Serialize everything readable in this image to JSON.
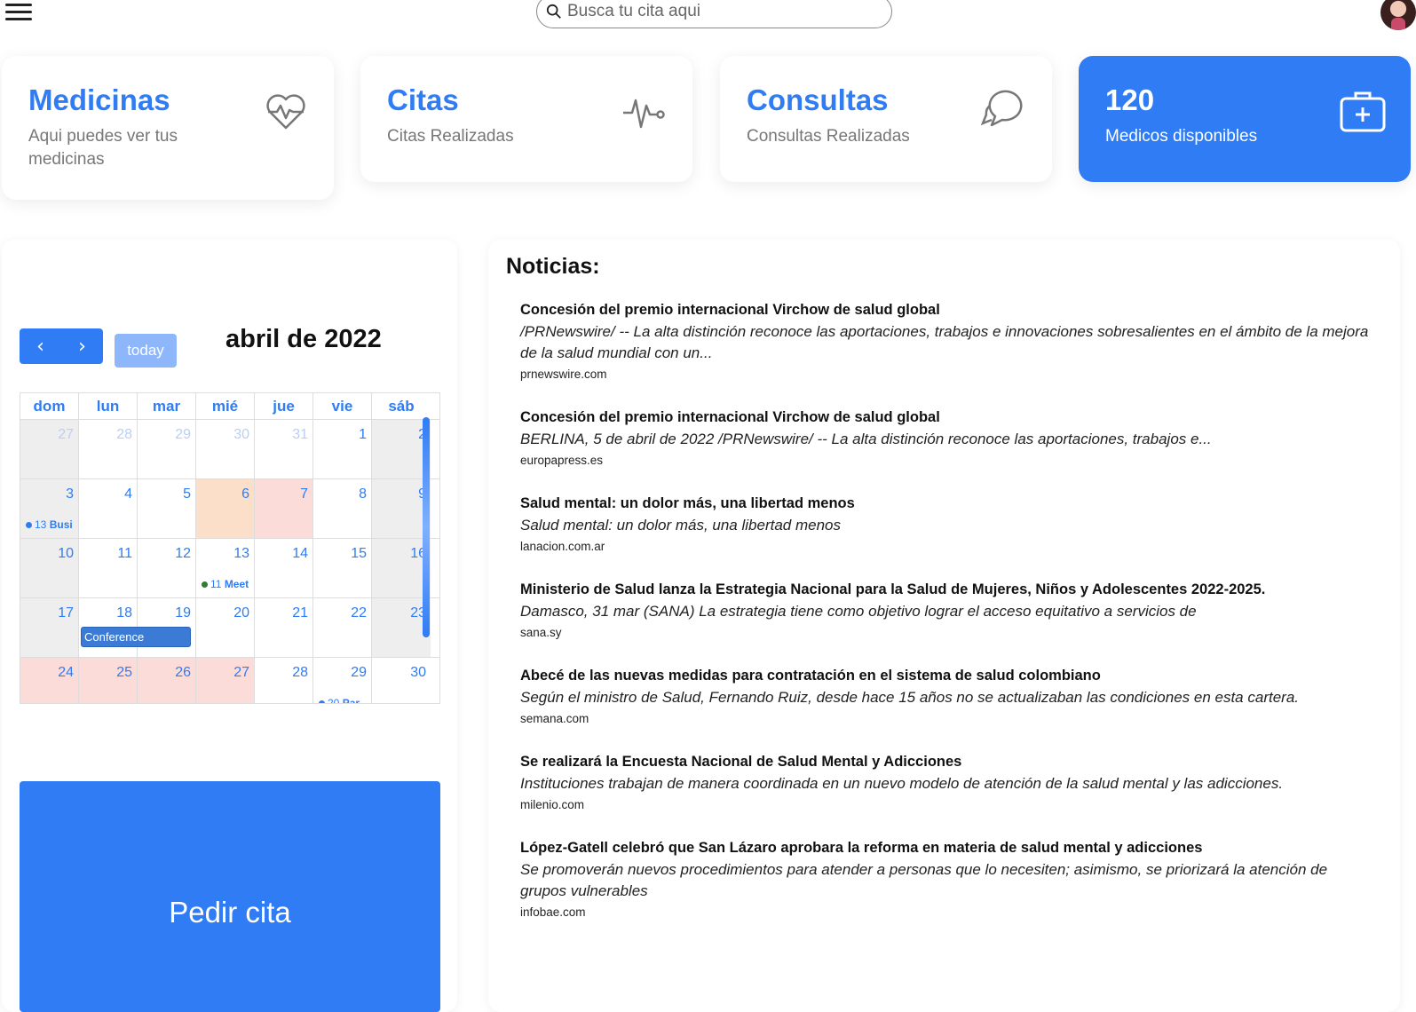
{
  "search": {
    "placeholder": "Busca tu cita aqui"
  },
  "cards": [
    {
      "title": "Medicinas",
      "subtitle": "Aqui puedes ver tus medicinas",
      "icon": "heart-pulse-icon"
    },
    {
      "title": "Citas",
      "subtitle": "Citas Realizadas",
      "icon": "activity-icon"
    },
    {
      "title": "Consultas",
      "subtitle": "Consultas Realizadas",
      "icon": "chat-icon"
    },
    {
      "title": "120",
      "subtitle": "Medicos disponibles",
      "icon": "medical-kit-icon"
    }
  ],
  "calendar": {
    "title": "abril de 2022",
    "today_label": "today",
    "prev_label": "‹",
    "next_label": "›",
    "weekdays": [
      "dom",
      "lun",
      "mar",
      "mié",
      "jue",
      "vie",
      "sáb"
    ],
    "weeks": [
      [
        "27",
        "28",
        "29",
        "30",
        "31",
        "1",
        "2"
      ],
      [
        "3",
        "4",
        "5",
        "6",
        "7",
        "8",
        "9"
      ],
      [
        "10",
        "11",
        "12",
        "13",
        "14",
        "15",
        "16"
      ],
      [
        "17",
        "18",
        "19",
        "20",
        "21",
        "22",
        "23"
      ],
      [
        "24",
        "25",
        "26",
        "27",
        "28",
        "29",
        "30"
      ]
    ],
    "events": {
      "e1_time": "13",
      "e1_title": "Busi",
      "e2_time": "11",
      "e2_title": "Meet",
      "e3_title": "Conference",
      "e4_time": "20",
      "e4_title": "Par"
    },
    "colors": {
      "accent": "#2f7cf5",
      "orange": "#fcdfc9",
      "pink": "#fbdcd8",
      "meet_dot": "#2e7d32"
    }
  },
  "pedir_label": "Pedir cita",
  "news": {
    "heading": "Noticias:",
    "items": [
      {
        "title": "Concesión del premio internacional Virchow de salud global",
        "desc": "/PRNewswire/ -- La alta distinción reconoce las aportaciones, trabajos e innovaciones sobresalientes en el ámbito de la mejora de la salud mundial con un...",
        "source": "prnewswire.com"
      },
      {
        "title": "Concesión del premio internacional Virchow de salud global",
        "desc": "BERLINA, 5 de abril de 2022 /PRNewswire/ -- La alta distinción reconoce las aportaciones, trabajos e...",
        "source": "europapress.es"
      },
      {
        "title": "Salud mental: un dolor más, una libertad menos",
        "desc": "Salud mental: un dolor más, una libertad menos",
        "source": "lanacion.com.ar"
      },
      {
        "title": "Ministerio de Salud lanza la Estrategia Nacional para la Salud de Mujeres, Niños y Adolescentes 2022-2025.",
        "desc": "Damasco, 31 mar (SANA) La estrategia tiene como objetivo lograr el acceso equitativo a servicios de",
        "source": "sana.sy"
      },
      {
        "title": "Abecé de las nuevas medidas para contratación en el sistema de salud colombiano",
        "desc": "Según el ministro de Salud, Fernando Ruiz, desde hace 15 años no se actualizaban las condiciones en esta cartera.",
        "source": "semana.com"
      },
      {
        "title": "Se realizará la Encuesta Nacional de Salud Mental y Adicciones",
        "desc": "Instituciones trabajan de manera coordinada en un nuevo modelo de atención de la salud mental y las adicciones.",
        "source": "milenio.com"
      },
      {
        "title": "López-Gatell celebró que San Lázaro aprobara la reforma en materia de salud mental y adicciones",
        "desc": "Se promoverán nuevos procedimientos para atender a personas que lo necesiten; asimismo, se priorizará la atención de grupos vulnerables",
        "source": "infobae.com"
      }
    ]
  }
}
